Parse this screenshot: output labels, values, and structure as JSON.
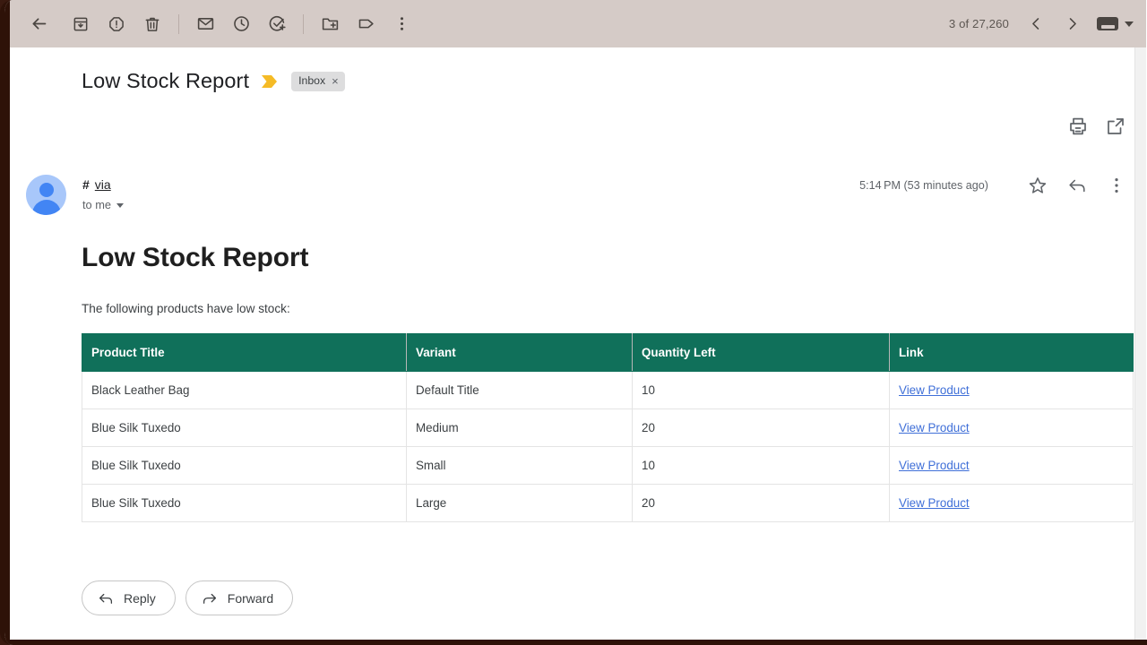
{
  "toolbar": {
    "back_label": "Back",
    "archive_label": "Archive",
    "spam_label": "Report spam",
    "delete_label": "Delete",
    "unread_label": "Mark as unread",
    "snooze_label": "Snooze",
    "tasks_label": "Add to tasks",
    "move_label": "Move to",
    "labels_label": "Labels",
    "more_label": "More",
    "message_count": "3 of 27,260",
    "prev_label": "Newer",
    "next_label": "Older",
    "keyboard_label": "Keyboard"
  },
  "email": {
    "subject": "Low Stock Report",
    "label_chip": "Inbox",
    "label_chip_remove": "×",
    "print_label": "Print all",
    "popout_label": "Open in new window",
    "sender_hash": "#",
    "sender_via": "via",
    "recipient": "to me",
    "timestamp": "5:14 PM (53 minutes ago)",
    "star_label": "Star",
    "reply_icon_label": "Reply",
    "more_label": "More"
  },
  "body": {
    "title": "Low Stock Report",
    "intro": "The following products have low stock:"
  },
  "table": {
    "headers": [
      "Product Title",
      "Variant",
      "Quantity Left",
      "Link"
    ],
    "rows": [
      {
        "product": "Black Leather Bag",
        "variant": "Default Title",
        "quantity": "10",
        "link": "View Product"
      },
      {
        "product": "Blue Silk Tuxedo",
        "variant": "Medium",
        "quantity": "20",
        "link": "View Product"
      },
      {
        "product": "Blue Silk Tuxedo",
        "variant": "Small",
        "quantity": "10",
        "link": "View Product"
      },
      {
        "product": "Blue Silk Tuxedo",
        "variant": "Large",
        "quantity": "20",
        "link": "View Product"
      }
    ],
    "header_bg": "#10705a",
    "link_color": "#3f6fd8"
  },
  "actions": {
    "reply": "Reply",
    "forward": "Forward"
  }
}
